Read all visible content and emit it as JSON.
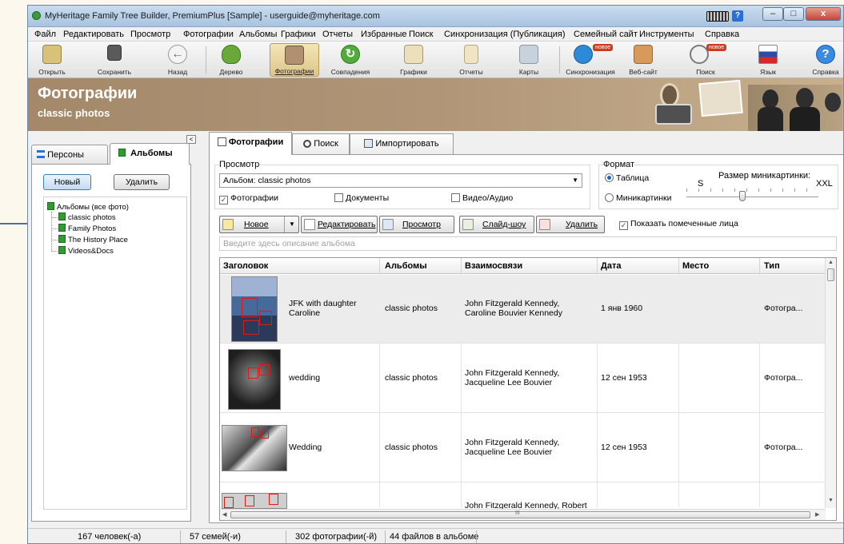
{
  "window": {
    "title": "MyHeritage Family Tree Builder, PremiumPlus [Sample] - userguide@myheritage.com",
    "minimize": "–",
    "maximize": "□",
    "close": "x",
    "help": "?"
  },
  "menu": [
    "Файл",
    "Редактировать",
    "Просмотр",
    "Фотографии",
    "Альбомы",
    "Графики",
    "Отчеты",
    "Избранные",
    "Поиск",
    "Синхронизация (Публикация)",
    "Семейный сайт",
    "Инструменты",
    "Справка"
  ],
  "toolbar": {
    "items": [
      {
        "label": "Открыть",
        "icon": "folder-open-icon",
        "color": "#c9b06a"
      },
      {
        "label": "Сохранить",
        "icon": "floppy-disk-icon",
        "color": "#505050"
      },
      {
        "label": "Назад",
        "icon": "back-arrow-icon",
        "color": "#4aa03c"
      },
      {
        "label": "Дерево",
        "icon": "tree-icon",
        "color": "#5a9a2c"
      },
      {
        "label": "Фотографии",
        "icon": "photos-icon",
        "color": "#a08060"
      },
      {
        "label": "Совпадения",
        "icon": "matches-icon",
        "color": "#4aa83c"
      },
      {
        "label": "Графики",
        "icon": "charts-icon",
        "color": "#c8b888"
      },
      {
        "label": "Отчеты",
        "icon": "reports-icon",
        "color": "#d8c89a"
      },
      {
        "label": "Карты",
        "icon": "maps-icon",
        "color": "#a8b8c8"
      },
      {
        "label": "Синхронизация",
        "icon": "sync-icon",
        "color": "#2e8ad6"
      },
      {
        "label": "Веб-сайт",
        "icon": "website-icon",
        "color": "#c87a3a"
      },
      {
        "label": "Поиск",
        "icon": "search-icon",
        "color": "#8a8a8a"
      },
      {
        "label": "Язык",
        "icon": "russian-flag-icon",
        "color": "#2a4ea6"
      },
      {
        "label": "Справка",
        "icon": "help-icon",
        "color": "#2e7ad6"
      }
    ],
    "badge_new": "новое"
  },
  "banner": {
    "title": "Фотографии",
    "subtitle": "classic photos"
  },
  "left_panel": {
    "tabs": [
      "Персоны",
      "Альбомы"
    ],
    "active_tab": "Альбомы",
    "new_button": "Новый",
    "delete_button": "Удалить",
    "tree_root": "Альбомы (все фото)",
    "albums": [
      "classic photos",
      "Family Photos",
      "The History Place",
      "Videos&Docs"
    ],
    "collapse": "<"
  },
  "main": {
    "tabs": [
      "Фотографии",
      "Поиск",
      "Импортировать"
    ],
    "active_tab": "Фотографии",
    "view_group": "Просмотр",
    "album_select": "Альбом: classic photos",
    "filters": [
      {
        "label": "Фотографии",
        "checked": true
      },
      {
        "label": "Документы",
        "checked": false
      },
      {
        "label": "Видео/Аудио",
        "checked": false
      }
    ],
    "format_group": "Формат",
    "format_options": [
      {
        "label": "Таблица",
        "selected": true
      },
      {
        "label": "Миникартинки",
        "selected": false
      }
    ],
    "thumb_size_label": "Размер миникартинки:",
    "thumb_size_min": "S",
    "thumb_size_max": "XXL",
    "thumb_size_value": 0.42,
    "actions": {
      "new": "Новое",
      "edit": "Редактировать",
      "view": "Просмотр",
      "slideshow": "Слайд-шоу",
      "delete": "Удалить",
      "show_faces": "Показать помеченные лица"
    },
    "show_faces_checked": true,
    "description_placeholder": "Введите здесь описание альбома",
    "table": {
      "columns": [
        "Заголовок",
        "Альбомы",
        "Взаимосвязи",
        "Дата",
        "Место",
        "Тип"
      ],
      "rows": [
        {
          "title_line1": "JFK with daughter",
          "title_line2": "Caroline",
          "album": "classic photos",
          "rel_line1": "John Fitzgerald Kennedy,",
          "rel_line2": "Caroline Bouvier Kennedy",
          "date": "1 янв 1960",
          "place": "",
          "type": "Фотогра..."
        },
        {
          "title_line1": "wedding",
          "title_line2": "",
          "album": "classic photos",
          "rel_line1": "John Fitzgerald Kennedy,",
          "rel_line2": "Jacqueline Lee Bouvier",
          "date": "12 сен 1953",
          "place": "",
          "type": "Фотогра..."
        },
        {
          "title_line1": "Wedding",
          "title_line2": "",
          "album": "classic photos",
          "rel_line1": "John Fitzgerald Kennedy,",
          "rel_line2": "Jacqueline Lee Bouvier",
          "date": "12 сен 1953",
          "place": "",
          "type": "Фотогра..."
        },
        {
          "title_line1": "",
          "title_line2": "",
          "album": "",
          "rel_line1": "John Fitzgerald Kennedy, Robert",
          "rel_line2": "",
          "date": "",
          "place": "",
          "type": ""
        }
      ],
      "hscroll_grip": "III"
    }
  },
  "status": {
    "people": "167 человек(-а)",
    "families": "57 семей(-и)",
    "photos": "302 фотографии(-й)",
    "files_in_album": "44 файлов в альбоме"
  }
}
